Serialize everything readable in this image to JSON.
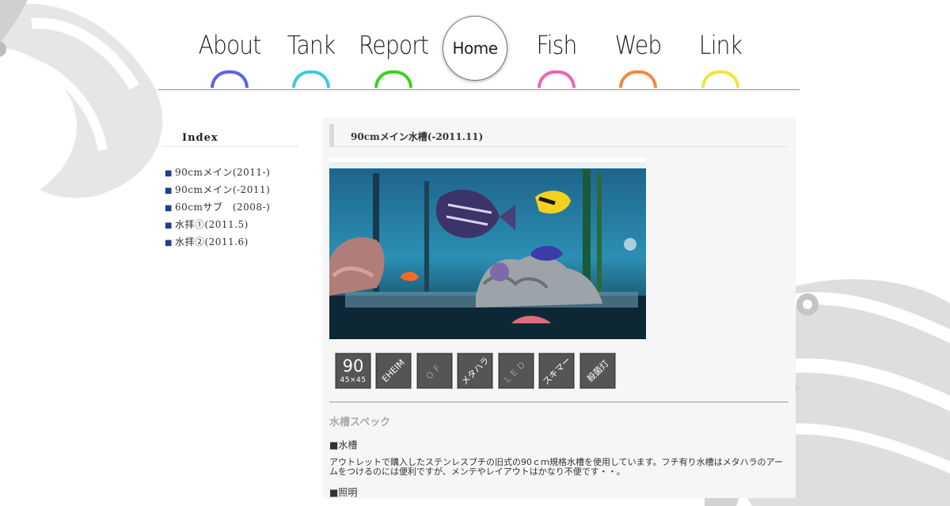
{
  "nav": {
    "items": [
      {
        "label": "About",
        "color": "#5b62e8"
      },
      {
        "label": "Tank",
        "color": "#3cc9e6"
      },
      {
        "label": "Report",
        "color": "#3ad11f"
      },
      {
        "label": "Fish",
        "color": "#f062b2"
      },
      {
        "label": "Web",
        "color": "#f2893a"
      },
      {
        "label": "Link",
        "color": "#f0e53a"
      }
    ],
    "home_label": "Home"
  },
  "sidebar": {
    "title": "Index",
    "items": [
      {
        "label": "90cmメイン(2011-)"
      },
      {
        "label": "90cmメイン(-2011)"
      },
      {
        "label": "60cmサブ　(2008-)"
      },
      {
        "label": "水拝①(2011.5)"
      },
      {
        "label": "水拝②(2011.6)"
      }
    ]
  },
  "main": {
    "title": "90cmメイン水槽(-2011.11)",
    "icons": [
      {
        "big": "90",
        "small": "45×45",
        "icon": "size-icon"
      },
      {
        "text": "EHEIM",
        "icon": "eheim-filter-icon"
      },
      {
        "text": "OF",
        "icon": "overflow-icon"
      },
      {
        "text": "メタハラ",
        "icon": "metal-halide-icon"
      },
      {
        "text": "LED",
        "icon": "led-icon"
      },
      {
        "text": "スキマー",
        "icon": "skimmer-icon"
      },
      {
        "text": "殺菌灯",
        "icon": "uv-sterilizer-icon"
      }
    ],
    "spec_heading": "水槽スペック",
    "tank_heading": "■水槽",
    "tank_text": "アウトレットで購入したステンレスブチの旧式の90ｃｍ規格水槽を使用しています。フチ有り水槽はメタハラのアームをつけるのには便利ですが、メンテやレイアウトはかなり不便です・・。",
    "light_heading": "■照明"
  }
}
